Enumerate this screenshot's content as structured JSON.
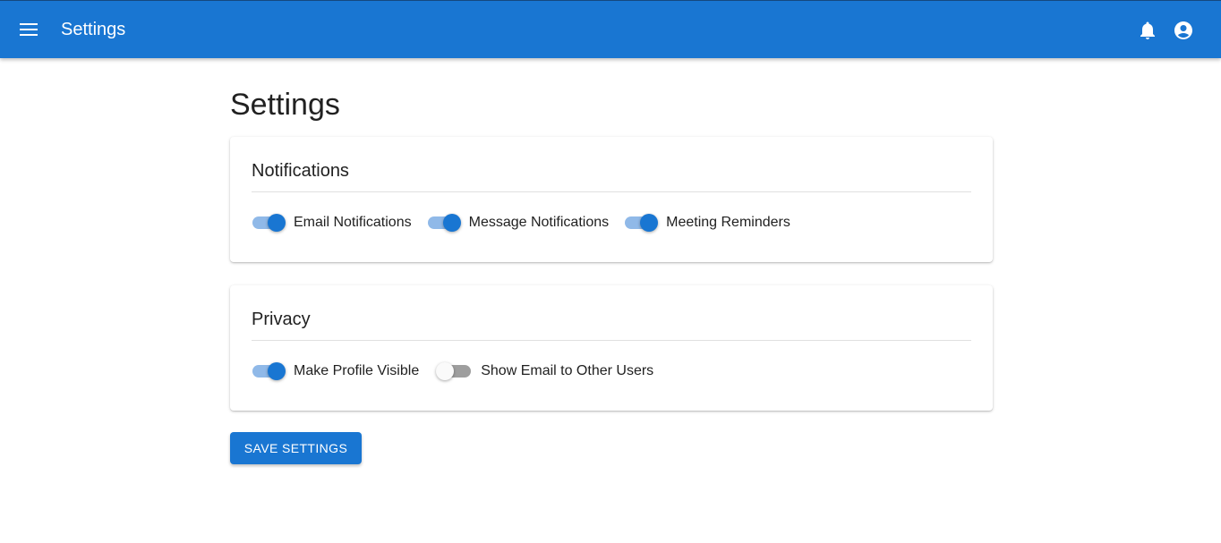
{
  "appbar": {
    "title": "Settings",
    "menu_icon": "menu-icon",
    "notifications_icon": "bell-icon",
    "account_icon": "account-circle-icon",
    "color": "#1976d2"
  },
  "page": {
    "title": "Settings"
  },
  "notifications": {
    "title": "Notifications",
    "toggles": [
      {
        "label": "Email Notifications",
        "checked": true
      },
      {
        "label": "Message Notifications",
        "checked": true
      },
      {
        "label": "Meeting Reminders",
        "checked": true
      }
    ]
  },
  "privacy": {
    "title": "Privacy",
    "toggles": [
      {
        "label": "Make Profile Visible",
        "checked": true
      },
      {
        "label": "Show Email to Other Users",
        "checked": false
      }
    ]
  },
  "actions": {
    "save_label": "SAVE SETTINGS"
  }
}
